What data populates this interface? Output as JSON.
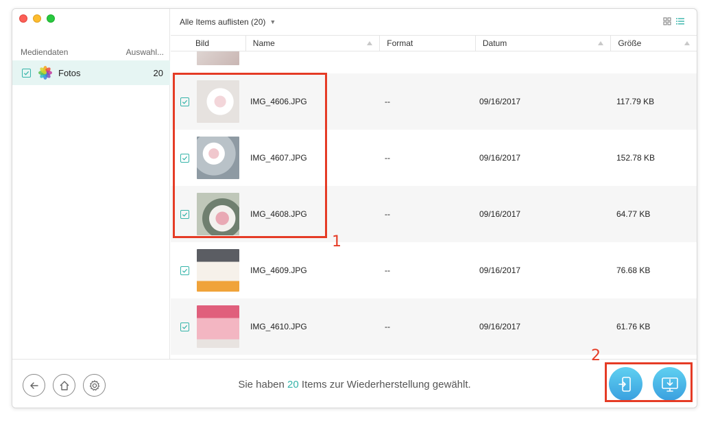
{
  "sidebar": {
    "header_left": "Mediendaten",
    "header_right": "Auswahl...",
    "item": {
      "label": "Fotos",
      "count": "20",
      "checked": true
    }
  },
  "toolbar": {
    "list_label": "Alle Items auflisten (20)",
    "view_icons": [
      "grid-view-icon",
      "list-view-icon"
    ]
  },
  "columns": [
    "Bild",
    "Name",
    "Format",
    "Datum",
    "Größe"
  ],
  "rows": [
    {
      "name": "IMG_4606.JPG",
      "format": "--",
      "date": "09/16/2017",
      "size": "117.79 KB",
      "checked": true
    },
    {
      "name": "IMG_4607.JPG",
      "format": "--",
      "date": "09/16/2017",
      "size": "152.78 KB",
      "checked": true
    },
    {
      "name": "IMG_4608.JPG",
      "format": "--",
      "date": "09/16/2017",
      "size": "64.77 KB",
      "checked": true
    },
    {
      "name": "IMG_4609.JPG",
      "format": "--",
      "date": "09/16/2017",
      "size": "76.68 KB",
      "checked": true
    },
    {
      "name": "IMG_4610.JPG",
      "format": "--",
      "date": "09/16/2017",
      "size": "61.76 KB",
      "checked": true
    }
  ],
  "status": {
    "prefix": "Sie haben ",
    "count": "20",
    "suffix": " Items zur Wiederherstellung gewählt."
  },
  "bottom_nav": [
    "back-icon",
    "home-icon",
    "settings-icon"
  ],
  "actions": [
    "to-device-icon",
    "to-computer-icon"
  ],
  "annotations": {
    "box1": "1",
    "box2": "2"
  },
  "colors": {
    "accent": "#33b3a8",
    "annotation": "#e53b25",
    "button": "#3aa0df"
  }
}
